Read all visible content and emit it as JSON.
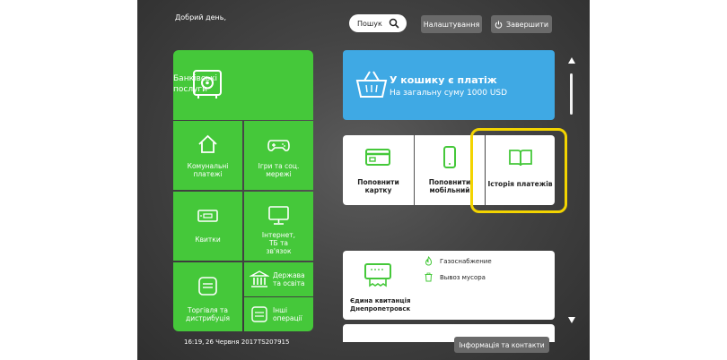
{
  "header": {
    "greeting": "Добрий день,",
    "search_label": "Пошук",
    "settings_label": "Налаштування",
    "exit_label": "Завершити"
  },
  "categories": {
    "banking": "Банківські послуги",
    "utilities": "Комунальні платежі",
    "games": "Ігри та соц. мережі",
    "tickets": "Квитки",
    "internet": "Інтернет, ТБ та зв'язок",
    "trade": "Торгівля та дистрибуція",
    "state": "Держава та освіта",
    "other": "Інші операції"
  },
  "cart": {
    "title": "У кошику є платіж",
    "subtitle": "На загальну суму 1000 USD"
  },
  "quick_actions": {
    "topup_card": "Поповнити картку",
    "topup_mobile": "Поповнити мобільний",
    "history": "Історія платежів"
  },
  "receipt": {
    "title": "Єдина квитанція Днепропетровск",
    "services": [
      "Газоснабжение",
      "Вывоз мусора"
    ]
  },
  "status": {
    "time": "16:19,",
    "date": "26 Червня 2017",
    "terminal_id": "TS207915"
  },
  "footer": {
    "info_label": "Інформація та контакти"
  },
  "colors": {
    "green_tile": "#45c83a",
    "cart_blue": "#3fa9e4",
    "highlight_yellow": "#f3d400"
  }
}
